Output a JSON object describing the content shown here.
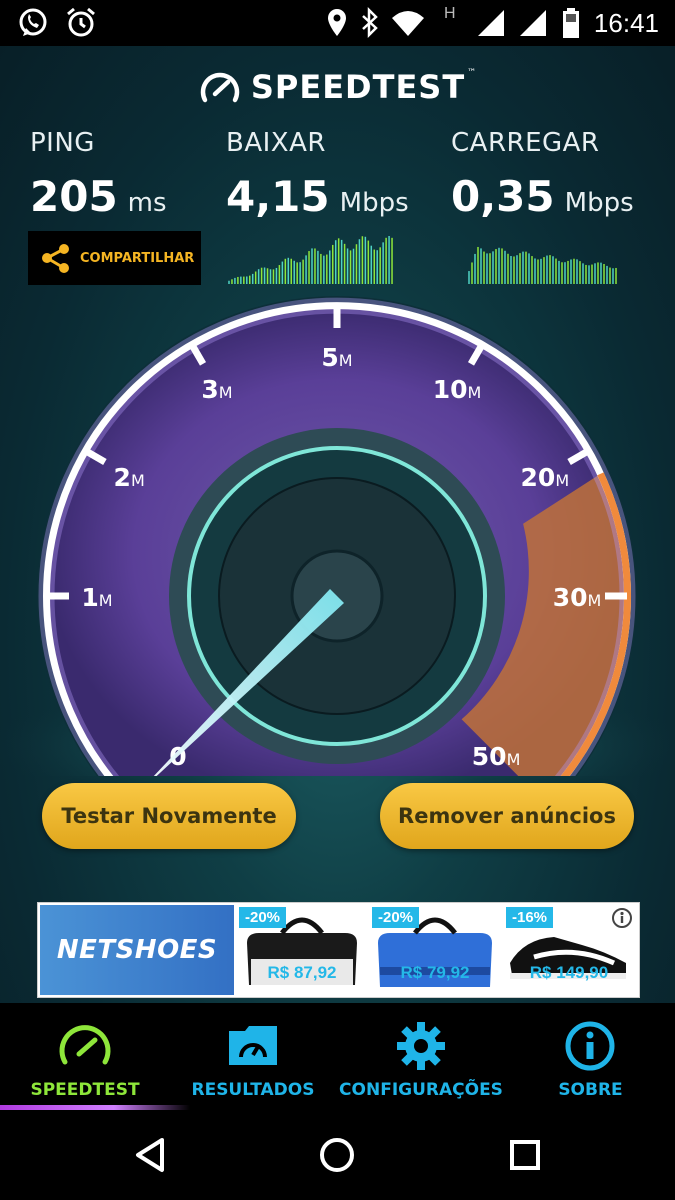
{
  "status_bar": {
    "time": "16:41",
    "network_letter": "H",
    "icons": [
      "whatsapp-icon",
      "alarm-icon",
      "location-icon",
      "bluetooth-icon",
      "wifi-icon",
      "signal-icon",
      "signal-icon",
      "battery-icon"
    ]
  },
  "header": {
    "title": "SPEEDTEST",
    "trademark": "™"
  },
  "metrics": {
    "ping": {
      "label": "PING",
      "value": "205",
      "unit": "ms"
    },
    "download": {
      "label": "BAIXAR",
      "value": "4,15",
      "unit": "Mbps"
    },
    "upload": {
      "label": "CARREGAR",
      "value": "0,35",
      "unit": "Mbps"
    }
  },
  "share_button": {
    "label": "COMPARTILHAR"
  },
  "gauge": {
    "ticks": [
      {
        "num": "0",
        "unit": ""
      },
      {
        "num": "1",
        "unit": "M"
      },
      {
        "num": "2",
        "unit": "M"
      },
      {
        "num": "3",
        "unit": "M"
      },
      {
        "num": "5",
        "unit": "M"
      },
      {
        "num": "10",
        "unit": "M"
      },
      {
        "num": "20",
        "unit": "M"
      },
      {
        "num": "30",
        "unit": "M"
      },
      {
        "num": "50",
        "unit": "M"
      }
    ],
    "needle_value_mbps": 0.35
  },
  "buttons": {
    "retest": "Testar Novamente",
    "remove_ads": "Remover anúncios"
  },
  "ad": {
    "brand": "NETSHOES",
    "products": [
      {
        "discount": "-20%",
        "price": "R$ 87,92"
      },
      {
        "discount": "-20%",
        "price": "R$ 79,92"
      },
      {
        "discount": "-16%",
        "price": "R$ 149,90"
      }
    ]
  },
  "bottom_nav": [
    {
      "label": "SPEEDTEST",
      "active": true
    },
    {
      "label": "RESULTADOS",
      "active": false
    },
    {
      "label": "CONFIGURAÇÕES",
      "active": false
    },
    {
      "label": "SOBRE",
      "active": false
    }
  ],
  "colors": {
    "accent_green": "#8ee63a",
    "nav_blue": "#1fb4e8",
    "button_gold": "#f2b833",
    "gauge_purple": "#a77be0",
    "gauge_orange": "#e8813a"
  }
}
